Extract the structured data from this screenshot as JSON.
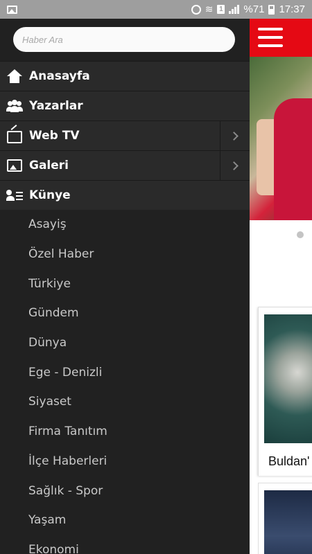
{
  "status_bar": {
    "battery": "%71",
    "time": "17:37",
    "sim": "1"
  },
  "drawer": {
    "search_placeholder": "Haber Ara",
    "main_items": [
      {
        "label": "Anasayfa",
        "icon": "home-icon"
      },
      {
        "label": "Yazarlar",
        "icon": "users-icon"
      },
      {
        "label": "Web TV",
        "icon": "tv-icon"
      },
      {
        "label": "Galeri",
        "icon": "gallery-icon"
      },
      {
        "label": "Künye",
        "icon": "contact-card-icon"
      }
    ],
    "categories": [
      "Asayiş",
      "Özel Haber",
      "Türkiye",
      "Gündem",
      "Dünya",
      "Ege - Denizli",
      "Siyaset",
      "Firma Tanıtım",
      "İlçe Haberleri",
      "Sağlık - Spor",
      "Yaşam",
      "Ekonomi"
    ]
  },
  "content": {
    "card_title": "Buldan'"
  },
  "colors": {
    "brand_red": "#e50914",
    "drawer_bg": "#212121",
    "status_bar": "#9e9e9e"
  }
}
